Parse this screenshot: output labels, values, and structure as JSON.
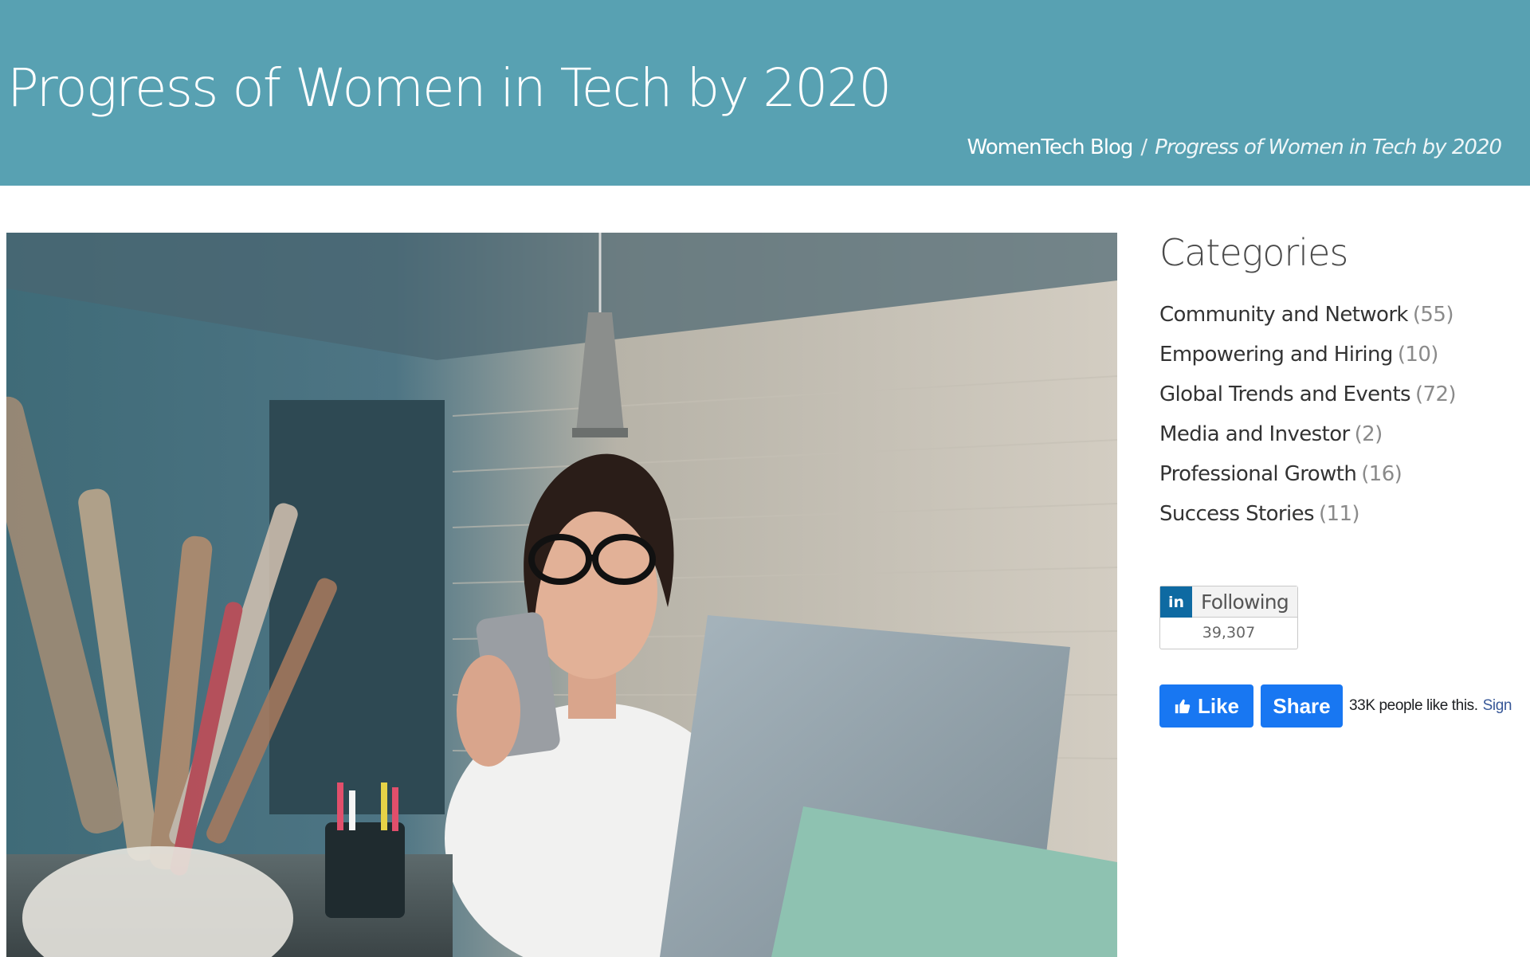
{
  "header": {
    "title": "Progress of Women in Tech by 2020",
    "breadcrumb": {
      "home": "WomenTech Blog",
      "separator": "/",
      "current": "Progress of Women in Tech by 2020"
    }
  },
  "sidebar": {
    "categories_title": "Categories",
    "categories": [
      {
        "name": "Community and Network",
        "count": "(55)"
      },
      {
        "name": "Empowering and Hiring",
        "count": "(10)"
      },
      {
        "name": "Global Trends and Events",
        "count": "(72)"
      },
      {
        "name": "Media and Investor",
        "count": "(2)"
      },
      {
        "name": "Professional Growth",
        "count": "(16)"
      },
      {
        "name": "Success Stories",
        "count": "(11)"
      }
    ],
    "linkedin": {
      "logo": "in",
      "label": "Following",
      "count": "39,307"
    },
    "facebook": {
      "like_label": "Like",
      "share_label": "Share",
      "text": "33K people like this.",
      "sign_link": "Sign"
    }
  },
  "colors": {
    "header_bg": "#58a1b2",
    "linkedin_blue": "#0e6aa2",
    "facebook_blue": "#1877f2"
  }
}
